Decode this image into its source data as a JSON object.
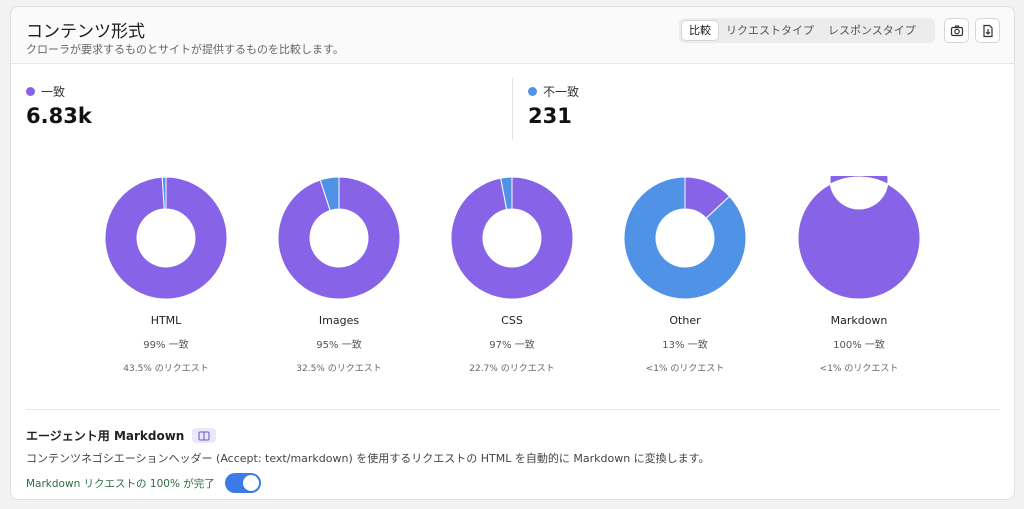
{
  "header": {
    "title": "コンテンツ形式",
    "subtitle": "クローラが要求するものとサイトが提供するものを比較します。",
    "tabs": [
      {
        "label": "比較",
        "active": true
      },
      {
        "label": "リクエストタイプ",
        "active": false
      },
      {
        "label": "レスポンスタイプ",
        "active": false
      }
    ],
    "icons": [
      "camera-icon",
      "download-icon"
    ]
  },
  "colors": {
    "match": "#8763e8",
    "mismatch": "#4f92e6"
  },
  "stats": {
    "match": {
      "label": "一致",
      "value": "6.83k"
    },
    "mismatch": {
      "label": "不一致",
      "value": "231"
    }
  },
  "chart_data": {
    "type": "pie",
    "charts": [
      {
        "name": "HTML",
        "match_pct": 99,
        "match_label": "99% 一致",
        "requests_label": "43.5% のリクエスト"
      },
      {
        "name": "Images",
        "match_pct": 95,
        "match_label": "95% 一致",
        "requests_label": "32.5% のリクエスト"
      },
      {
        "name": "CSS",
        "match_pct": 97,
        "match_label": "97% 一致",
        "requests_label": "22.7% のリクエスト"
      },
      {
        "name": "Other",
        "match_pct": 13,
        "match_label": "13% 一致",
        "requests_label": "<1% のリクエスト"
      },
      {
        "name": "Markdown",
        "match_pct": 100,
        "match_label": "100% 一致",
        "requests_label": "<1% のリクエスト"
      }
    ]
  },
  "markdown": {
    "title": "エージェント用 Markdown",
    "description": "コンテンツネゴシエーションヘッダー (Accept: text/markdown) を使用するリクエストの HTML を自動的に Markdown に変換します。",
    "status": "Markdown リクエストの 100% が完了",
    "enabled": true
  }
}
